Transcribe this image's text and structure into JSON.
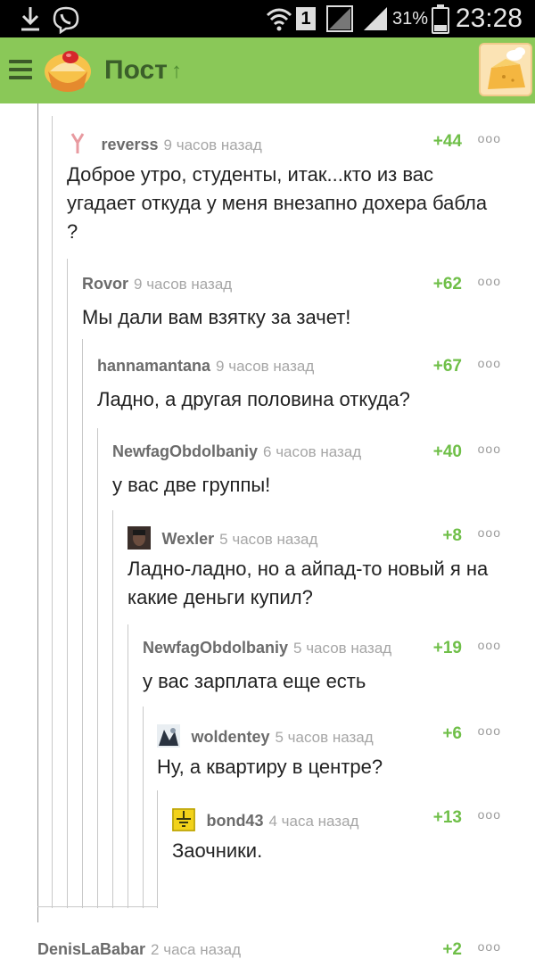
{
  "status_bar": {
    "time": "23:28",
    "battery_percent": "31%",
    "sim_number": "1",
    "icons": [
      "download-icon",
      "viber-icon",
      "wifi-icon",
      "sim-icon",
      "signal-icon",
      "signal-icon",
      "battery-icon"
    ]
  },
  "app_bar": {
    "title": "Пост",
    "up_icon": "↑",
    "accent_color": "#8ac858"
  },
  "comments": [
    {
      "author": "reverss",
      "time": "9 часов назад",
      "rating": "+44",
      "text": "Доброе утро, студенты, итак...кто из вас угадает откуда у меня внезапно дохера бабла ?",
      "avatar": "y-icon"
    },
    {
      "author": "Rovor",
      "time": "9 часов назад",
      "rating": "+62",
      "text": "Мы дали вам взятку за зачет!"
    },
    {
      "author": "hannamantana",
      "time": "9 часов назад",
      "rating": "+67",
      "text": "Ладно, а другая половина откуда?"
    },
    {
      "author": "NewfagObdolbaniy",
      "time": "6 часов назад",
      "rating": "+40",
      "text": "у вас две группы!"
    },
    {
      "author": "Wexler",
      "time": "5 часов назад",
      "rating": "+8",
      "text": "Ладно-ладно, но а айпад-то новый я на какие деньги купил?",
      "avatar": "photo-avatar"
    },
    {
      "author": "NewfagObdolbaniy",
      "time": "5 часов назад",
      "rating": "+19",
      "text": "у вас зарплата еще есть"
    },
    {
      "author": "woldentey",
      "time": "5 часов назад",
      "rating": "+6",
      "text": "Ну, а квартиру в центре?",
      "avatar": "photo-avatar"
    },
    {
      "author": "bond43",
      "time": "4 часа назад",
      "rating": "+13",
      "text": "Заочники.",
      "avatar": "ground-symbol-avatar"
    },
    {
      "author": "DenisLaBabar",
      "time": "2 часа назад",
      "rating": "+2",
      "text": ""
    }
  ],
  "menu_glyph": "ooo"
}
